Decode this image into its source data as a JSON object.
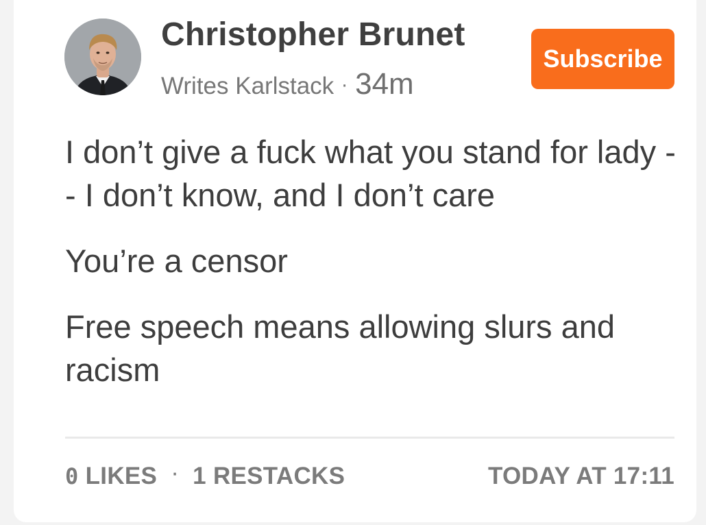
{
  "post": {
    "author": {
      "name": "Christopher Brunet",
      "writes_label": "Writes Karlstack",
      "separator": "·",
      "time_ago": "34m"
    },
    "subscribe_label": "Subscribe",
    "paragraphs": [
      "I don’t give a fuck what you stand for lady -- I don’t know, and I don’t care",
      "You’re a censor",
      "Free speech means allowing slurs and racism"
    ],
    "footer": {
      "likes_count": "0",
      "likes_label": "LIKES",
      "separator": "·",
      "restacks": "1 RESTACKS",
      "timestamp": "TODAY AT 17:11"
    }
  },
  "colors": {
    "accent": "#f96d1c",
    "text": "#3d3d3d",
    "muted": "#7b7b7b"
  },
  "icons": [
    "author-avatar"
  ]
}
